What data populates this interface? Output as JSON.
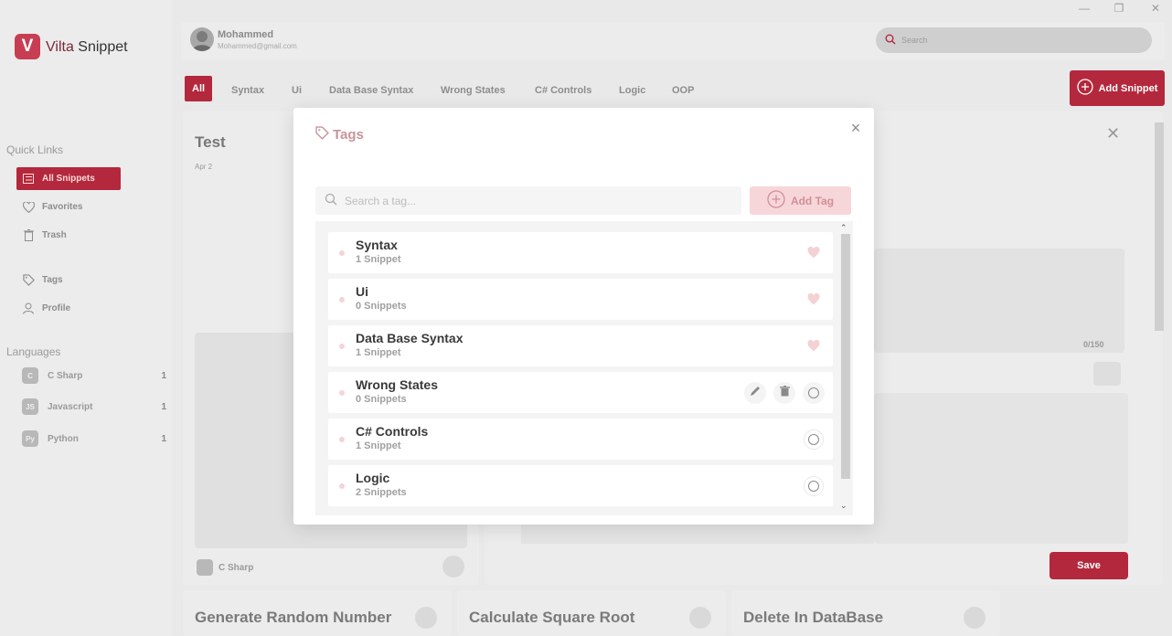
{
  "window": {
    "minimize": "—",
    "restore": "❐",
    "close": "✕"
  },
  "brand": {
    "logo": "V",
    "name_part1": "Vilta",
    "name_part2": " Snippet"
  },
  "sidebar": {
    "quick_links_heading": "Quick Links",
    "items": [
      {
        "label": "All Snippets",
        "icon": "list-icon"
      },
      {
        "label": "Favorites",
        "icon": "heart-icon"
      },
      {
        "label": "Trash",
        "icon": "trash-icon"
      },
      {
        "label": "Tags",
        "icon": "tag-icon"
      },
      {
        "label": "Profile",
        "icon": "user-icon"
      }
    ],
    "languages_heading": "Languages",
    "languages": [
      {
        "name": "C Sharp",
        "count": "1",
        "badge": "C"
      },
      {
        "name": "Javascript",
        "count": "1",
        "badge": "JS"
      },
      {
        "name": "Python",
        "count": "1",
        "badge": "Py"
      }
    ]
  },
  "header": {
    "user_name": "Mohammed",
    "user_email": "Mohammed@gmail.com",
    "search_placeholder": "Search"
  },
  "filters": [
    "All",
    "Syntax",
    "Ui",
    "Data Base Syntax",
    "Wrong States",
    "C# Controls",
    "Logic",
    "OOP"
  ],
  "add_snippet_label": "Add Snippet",
  "background": {
    "card_title": "Test",
    "card_date": "Apr 2",
    "card_language": "C Sharp",
    "char_count": "0/150",
    "save_label": "Save",
    "bottom_cards": [
      "Generate Random Number",
      "Calculate Square Root",
      "Delete In DataBase"
    ]
  },
  "modal": {
    "title": "Tags",
    "close": "×",
    "search_placeholder": "Search a tag...",
    "add_tag_label": "Add Tag",
    "tags": [
      {
        "name": "Syntax",
        "count": "1 Snippet",
        "state": "favorite"
      },
      {
        "name": "Ui",
        "count": "0 Snippets",
        "state": "favorite"
      },
      {
        "name": "Data Base Syntax",
        "count": "1 Snippet",
        "state": "favorite"
      },
      {
        "name": "Wrong States",
        "count": "0 Snippets",
        "state": "hover"
      },
      {
        "name": "C# Controls",
        "count": "1 Snippet",
        "state": "radio"
      },
      {
        "name": "Logic",
        "count": "2 Snippets",
        "state": "radio"
      }
    ]
  },
  "colors": {
    "accent": "#b3283c",
    "accent_light": "#f7d6d9"
  }
}
